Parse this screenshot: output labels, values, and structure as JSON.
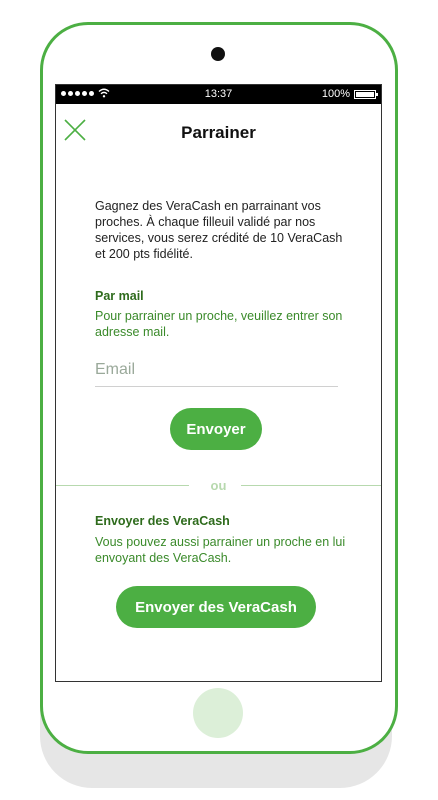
{
  "status_bar": {
    "time": "13:37",
    "battery": "100%",
    "battery_level": 1.0
  },
  "header": {
    "title": "Parrainer",
    "close_icon": "close-icon"
  },
  "intro_text": "Gagnez des VeraCash en parrainant vos proches. À chaque filleuil validé par nos services, vous serez crédité de 10 VeraCash et 200 pts fidélité.",
  "mail_section": {
    "title": "Par mail",
    "description": "Pour parrainer un proche, veuillez entrer son adresse mail.",
    "email_placeholder": "Email",
    "email_value": "",
    "send_label": "Envoyer"
  },
  "separator_label": "ou",
  "veracash_section": {
    "title": "Envoyer des VeraCash",
    "description": "Vous pouvez aussi parrainer un proche en lui envoyant des VeraCash.",
    "send_label": "Envoyer des VeraCash"
  },
  "colors": {
    "accent": "#4caf43",
    "section_title": "#2e6b1c",
    "section_text": "#3a8a2a",
    "divider": "#b7d9ae"
  }
}
